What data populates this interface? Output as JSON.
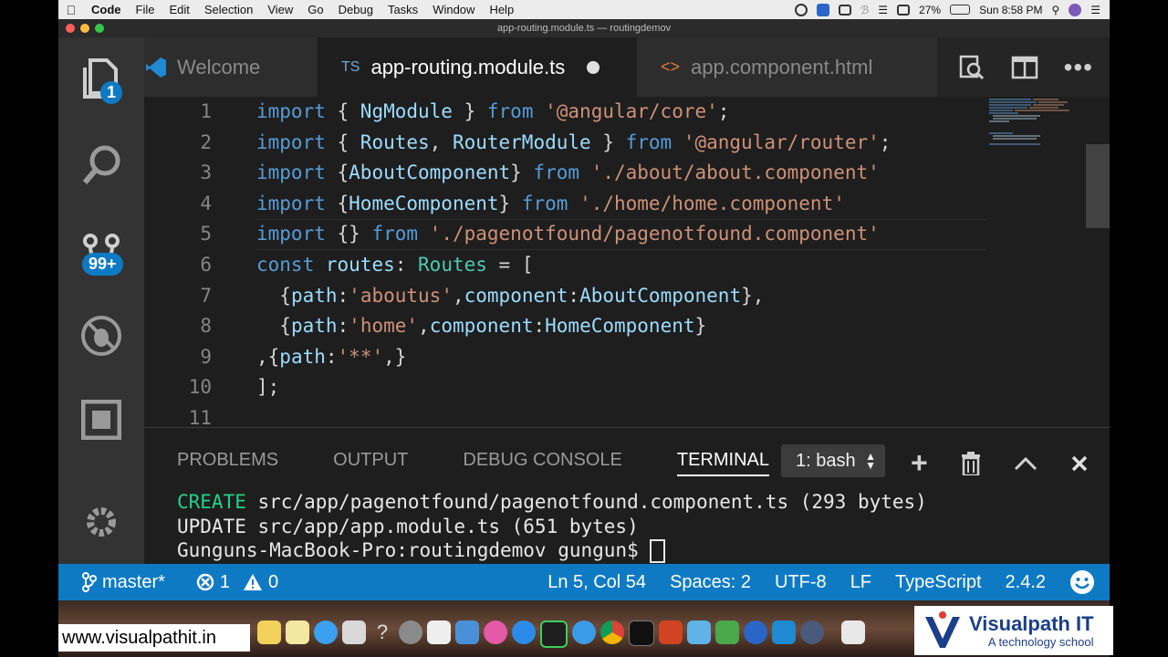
{
  "menubar": {
    "app": "Code",
    "items": [
      "File",
      "Edit",
      "Selection",
      "View",
      "Go",
      "Debug",
      "Tasks",
      "Window",
      "Help"
    ],
    "battery": "27%",
    "clock": "Sun 8:58 PM"
  },
  "window": {
    "title": "app-routing.module.ts — routingdemov"
  },
  "activity": {
    "explorer_badge": "1",
    "scm_badge": "99+"
  },
  "tabs": [
    {
      "label": "Welcome"
    },
    {
      "prefix": "TS",
      "label": "app-routing.module.ts"
    },
    {
      "prefix": "<>",
      "label": "app.component.html"
    }
  ],
  "editor": {
    "line_numbers": [
      "1",
      "2",
      "3",
      "4",
      "5",
      "6",
      "7",
      "8",
      "9",
      "10",
      "11"
    ],
    "lines": [
      [
        [
          "kw",
          "import"
        ],
        [
          "pu",
          " { "
        ],
        [
          "id",
          "NgModule"
        ],
        [
          "pu",
          " } "
        ],
        [
          "kw",
          "from"
        ],
        [
          "pu",
          " "
        ],
        [
          "str",
          "'@angular/core'"
        ],
        [
          "pu",
          ";"
        ]
      ],
      [
        [
          "kw",
          "import"
        ],
        [
          "pu",
          " { "
        ],
        [
          "id",
          "Routes"
        ],
        [
          "pu",
          ", "
        ],
        [
          "id",
          "RouterModule"
        ],
        [
          "pu",
          " } "
        ],
        [
          "kw",
          "from"
        ],
        [
          "pu",
          " "
        ],
        [
          "str",
          "'@angular/router'"
        ],
        [
          "pu",
          ";"
        ]
      ],
      [
        [
          "kw",
          "import"
        ],
        [
          "pu",
          " {"
        ],
        [
          "id",
          "AboutComponent"
        ],
        [
          "pu",
          "} "
        ],
        [
          "kw",
          "from"
        ],
        [
          "pu",
          " "
        ],
        [
          "str",
          "'./about/about.component'"
        ]
      ],
      [
        [
          "kw",
          "import"
        ],
        [
          "pu",
          " {"
        ],
        [
          "id",
          "HomeComponent"
        ],
        [
          "pu",
          "} "
        ],
        [
          "kw",
          "from"
        ],
        [
          "pu",
          " "
        ],
        [
          "str",
          "'./home/home.component'"
        ]
      ],
      [
        [
          "kw",
          "import"
        ],
        [
          "pu",
          " {} "
        ],
        [
          "kw",
          "from"
        ],
        [
          "pu",
          " "
        ],
        [
          "str",
          "'./pagenotfound/pagenotfound.component'"
        ]
      ],
      [
        [
          "kw",
          "const"
        ],
        [
          "pu",
          " "
        ],
        [
          "id",
          "routes"
        ],
        [
          "pu",
          ": "
        ],
        [
          "ty",
          "Routes"
        ],
        [
          "pu",
          " = ["
        ]
      ],
      [
        [
          "pu",
          "  {"
        ],
        [
          "id",
          "path"
        ],
        [
          "pu",
          ":"
        ],
        [
          "str",
          "'aboutus'"
        ],
        [
          "pu",
          ","
        ],
        [
          "id",
          "component"
        ],
        [
          "pu",
          ":"
        ],
        [
          "id",
          "AboutComponent"
        ],
        [
          "pu",
          "},"
        ]
      ],
      [
        [
          "pu",
          "  {"
        ],
        [
          "id",
          "path"
        ],
        [
          "pu",
          ":"
        ],
        [
          "str",
          "'home'"
        ],
        [
          "pu",
          ","
        ],
        [
          "id",
          "component"
        ],
        [
          "pu",
          ":"
        ],
        [
          "id",
          "HomeComponent"
        ],
        [
          "pu",
          "}"
        ]
      ],
      [
        [
          "pu",
          ",{"
        ],
        [
          "id",
          "path"
        ],
        [
          "pu",
          ":"
        ],
        [
          "str",
          "'**'"
        ],
        [
          "pu",
          ",}"
        ]
      ],
      [
        [
          "pu",
          "];"
        ]
      ],
      [
        [
          "pu",
          ""
        ]
      ]
    ]
  },
  "panel": {
    "tabs": [
      "PROBLEMS",
      "OUTPUT",
      "DEBUG CONSOLE",
      "TERMINAL"
    ],
    "terminal_select": "1: bash",
    "terminal_lines": [
      {
        "tag": "CREATE",
        "text": " src/app/pagenotfound/pagenotfound.component.ts (293 bytes)"
      },
      {
        "tag": "",
        "text": "UPDATE src/app/app.module.ts (651 bytes)"
      },
      {
        "tag": "",
        "text": "Gunguns-MacBook-Pro:routingdemov gungun$ "
      }
    ]
  },
  "statusbar": {
    "branch": "master*",
    "errors": "1",
    "warnings": "0",
    "position": "Ln 5, Col 54",
    "spaces": "Spaces: 2",
    "encoding": "UTF-8",
    "eol": "LF",
    "language": "TypeScript",
    "version": "2.4.2"
  },
  "watermark": {
    "url": "www.visualpathit.in",
    "brand": "Visualpath IT",
    "tagline": "A technology school"
  },
  "colors": {
    "accent": "#0e7ac4",
    "keyword": "#569cd6",
    "identifier": "#9cdcfe",
    "string": "#ce9178",
    "type": "#4ec9b0"
  }
}
